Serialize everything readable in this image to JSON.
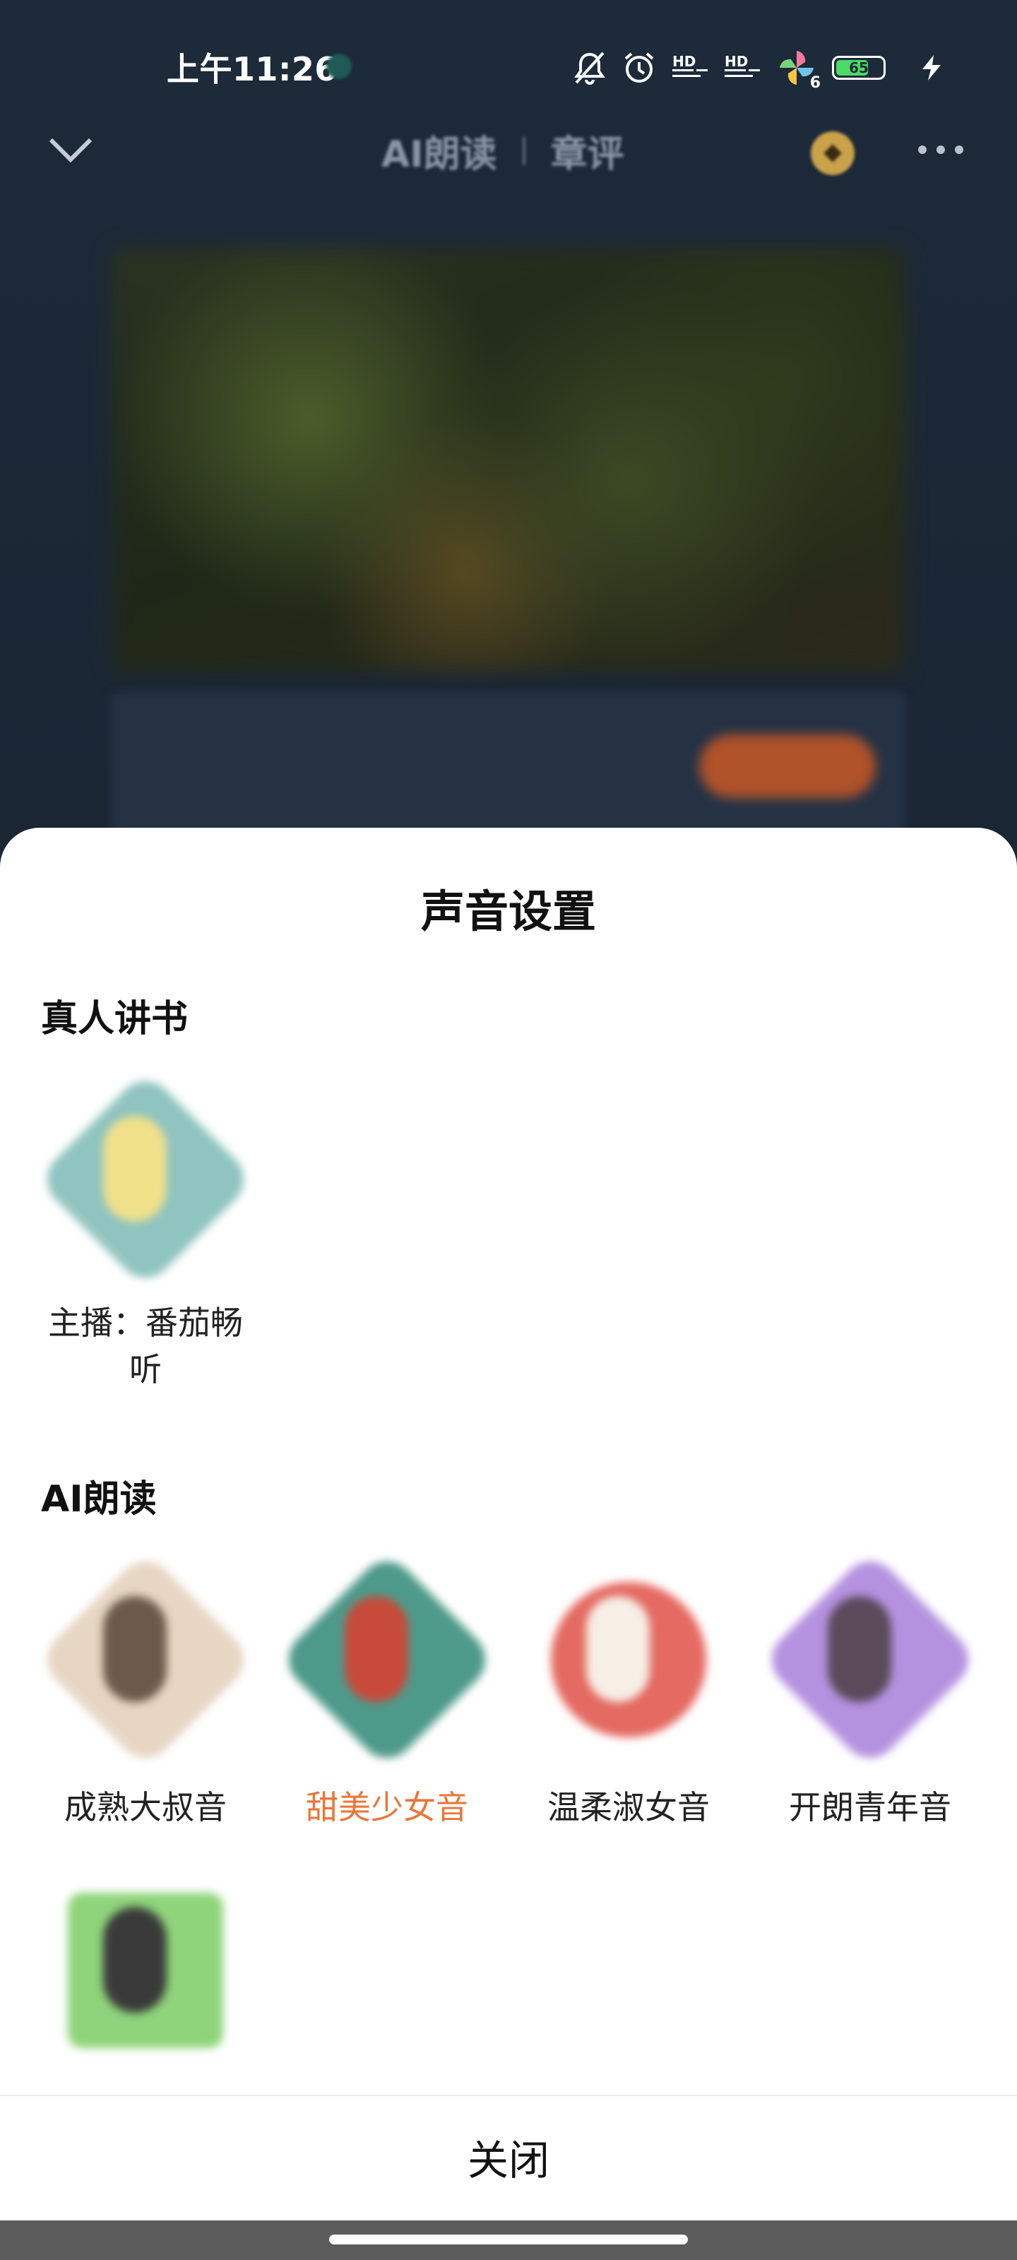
{
  "status_bar": {
    "time": "上午11:26",
    "icons": [
      "mute-bell-icon",
      "alarm-icon",
      "hd-signal-icon",
      "hd-signal-icon",
      "pinwheel-icon",
      "battery-icon",
      "charging-icon"
    ],
    "hd_label": "HD",
    "network_badge": "6",
    "battery_level": "65"
  },
  "top_nav": {
    "tabs": [
      "AI朗读",
      "章评"
    ]
  },
  "sheet": {
    "title": "声音设置",
    "human_section": {
      "label": "真人讲书",
      "items": [
        {
          "name": "主播：番茄畅听"
        }
      ]
    },
    "ai_section": {
      "label": "AI朗读",
      "items": [
        {
          "name": "成熟大叔音",
          "selected": false
        },
        {
          "name": "甜美少女音",
          "selected": true
        },
        {
          "name": "温柔淑女音",
          "selected": false
        },
        {
          "name": "开朗青年音",
          "selected": false
        },
        {
          "name": "",
          "selected": false
        }
      ]
    },
    "close_label": "关闭"
  },
  "colors": {
    "accent_selected": "#e8773a",
    "sheet_bg": "#ffffff",
    "backdrop": "#1b2838"
  }
}
